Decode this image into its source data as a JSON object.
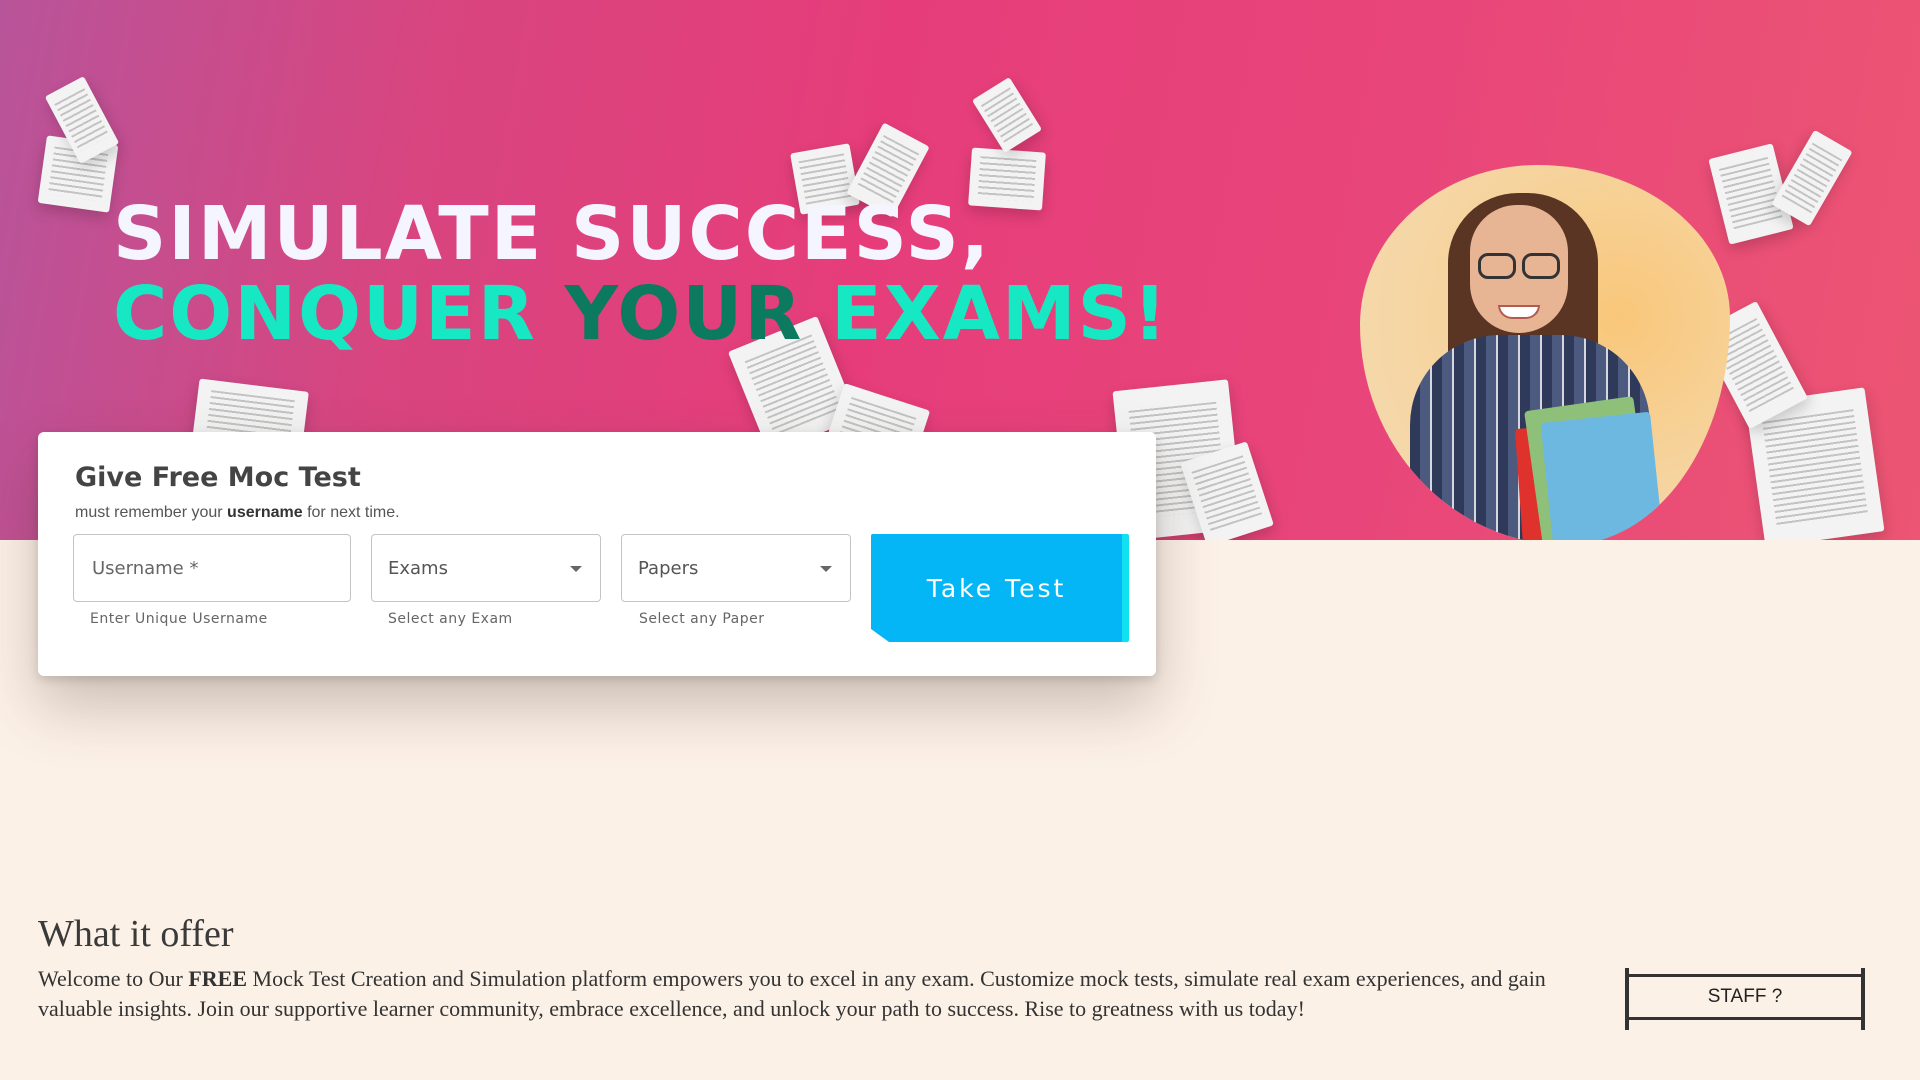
{
  "hero": {
    "headline_line1": "SIMULATE SUCCESS,",
    "headline_line2_a": "CONQUER ",
    "headline_line2_b": "YOUR",
    "headline_line2_c": " EXAMS!"
  },
  "form": {
    "title": "Give Free Moc Test",
    "subtitle_prefix": "must remember your ",
    "subtitle_bold": "username",
    "subtitle_suffix": " for next time.",
    "username_placeholder": "Username *",
    "username_helper": "Enter Unique Username",
    "exams_label": "Exams",
    "exams_helper": "Select any Exam",
    "papers_label": "Papers",
    "papers_helper": "Select any Paper",
    "submit_label": "Take Test"
  },
  "offer": {
    "title": "What it offer",
    "text_prefix": "Welcome to Our ",
    "text_bold": "FREE",
    "text_suffix": " Mock Test Creation and Simulation platform empowers you to excel in any exam. Customize mock tests, simulate real exam experiences, and gain valuable insights. Join our supportive learner community, embrace excellence, and unlock your path to success. Rise to greatness with us today!"
  },
  "staff_button": "STAFF ?",
  "colors": {
    "hero_pink": "#e63d7a",
    "accent_teal": "#17e8c4",
    "accent_dark_teal": "#0b7a5e",
    "button_blue": "#05b6f6",
    "page_bg": "#fcf1e7"
  }
}
